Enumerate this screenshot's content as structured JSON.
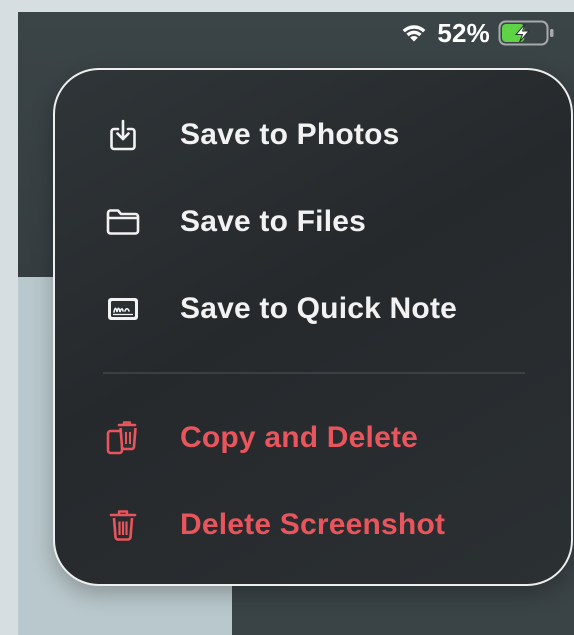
{
  "status_bar": {
    "battery_percent": "52%",
    "battery_level": 0.52,
    "battery_charging": true,
    "icons": [
      "wifi-icon",
      "battery-charging-icon"
    ]
  },
  "menu": {
    "items": [
      {
        "label": "Save to Photos",
        "icon": "save-photo-icon",
        "destructive": false
      },
      {
        "label": "Save to Files",
        "icon": "folder-icon",
        "destructive": false
      },
      {
        "label": "Save to Quick Note",
        "icon": "quick-note-icon",
        "destructive": false
      },
      {
        "label": "Copy and Delete",
        "icon": "copy-trash-icon",
        "destructive": true
      },
      {
        "label": "Delete Screenshot",
        "icon": "trash-icon",
        "destructive": true
      }
    ]
  },
  "colors": {
    "menu_background": "#2a2f32",
    "text": "#f2f2f2",
    "destructive": "#e8555c",
    "battery_fill": "#5fd346"
  }
}
